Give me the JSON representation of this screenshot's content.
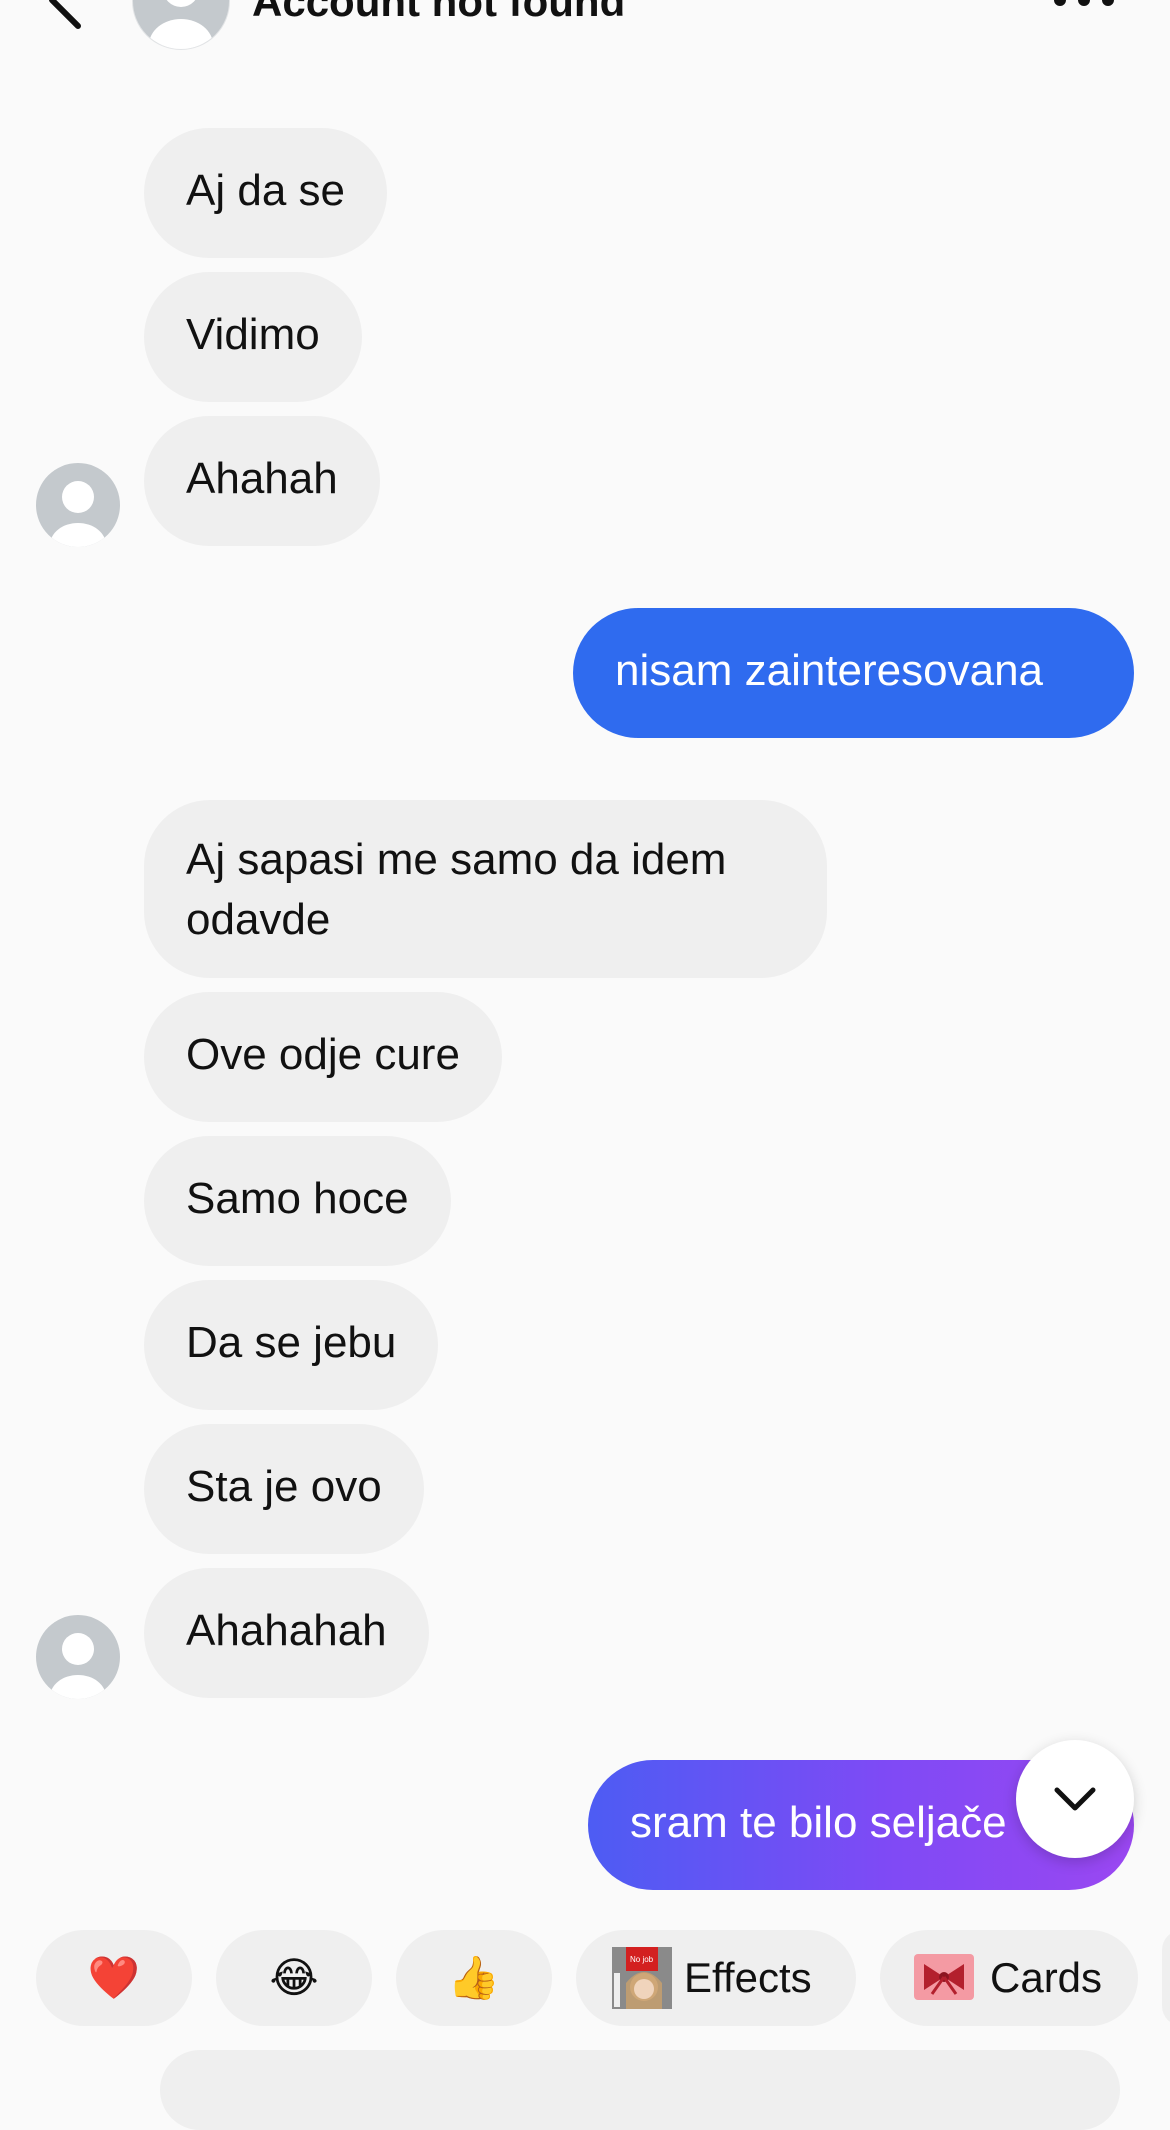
{
  "header": {
    "title": "Account not found"
  },
  "messages": {
    "m1": "Aj da se",
    "m2": "Vidimo",
    "m3": "Ahahah",
    "m4": "nisam zainteresovana",
    "m5": "Aj sapasi me samo da idem odavde",
    "m6": "Ove odje cure",
    "m7": "Samo hoce",
    "m8": "Da se jebu",
    "m9": "Sta je ovo",
    "m10": "Ahahahah",
    "m11": "sram te bilo seljače"
  },
  "quick_reactions": {
    "heart": "❤️",
    "laugh": "😂",
    "thumbs": "👍"
  },
  "tools": {
    "effects_label": "Effects",
    "effects_badge": "No job",
    "cards_label": "Cards"
  },
  "colors": {
    "outgoing_blue": "#2f6bef",
    "outgoing_gradient_start": "#4d5cf3",
    "outgoing_gradient_end": "#9a47f1",
    "incoming_bubble": "#efefef"
  }
}
